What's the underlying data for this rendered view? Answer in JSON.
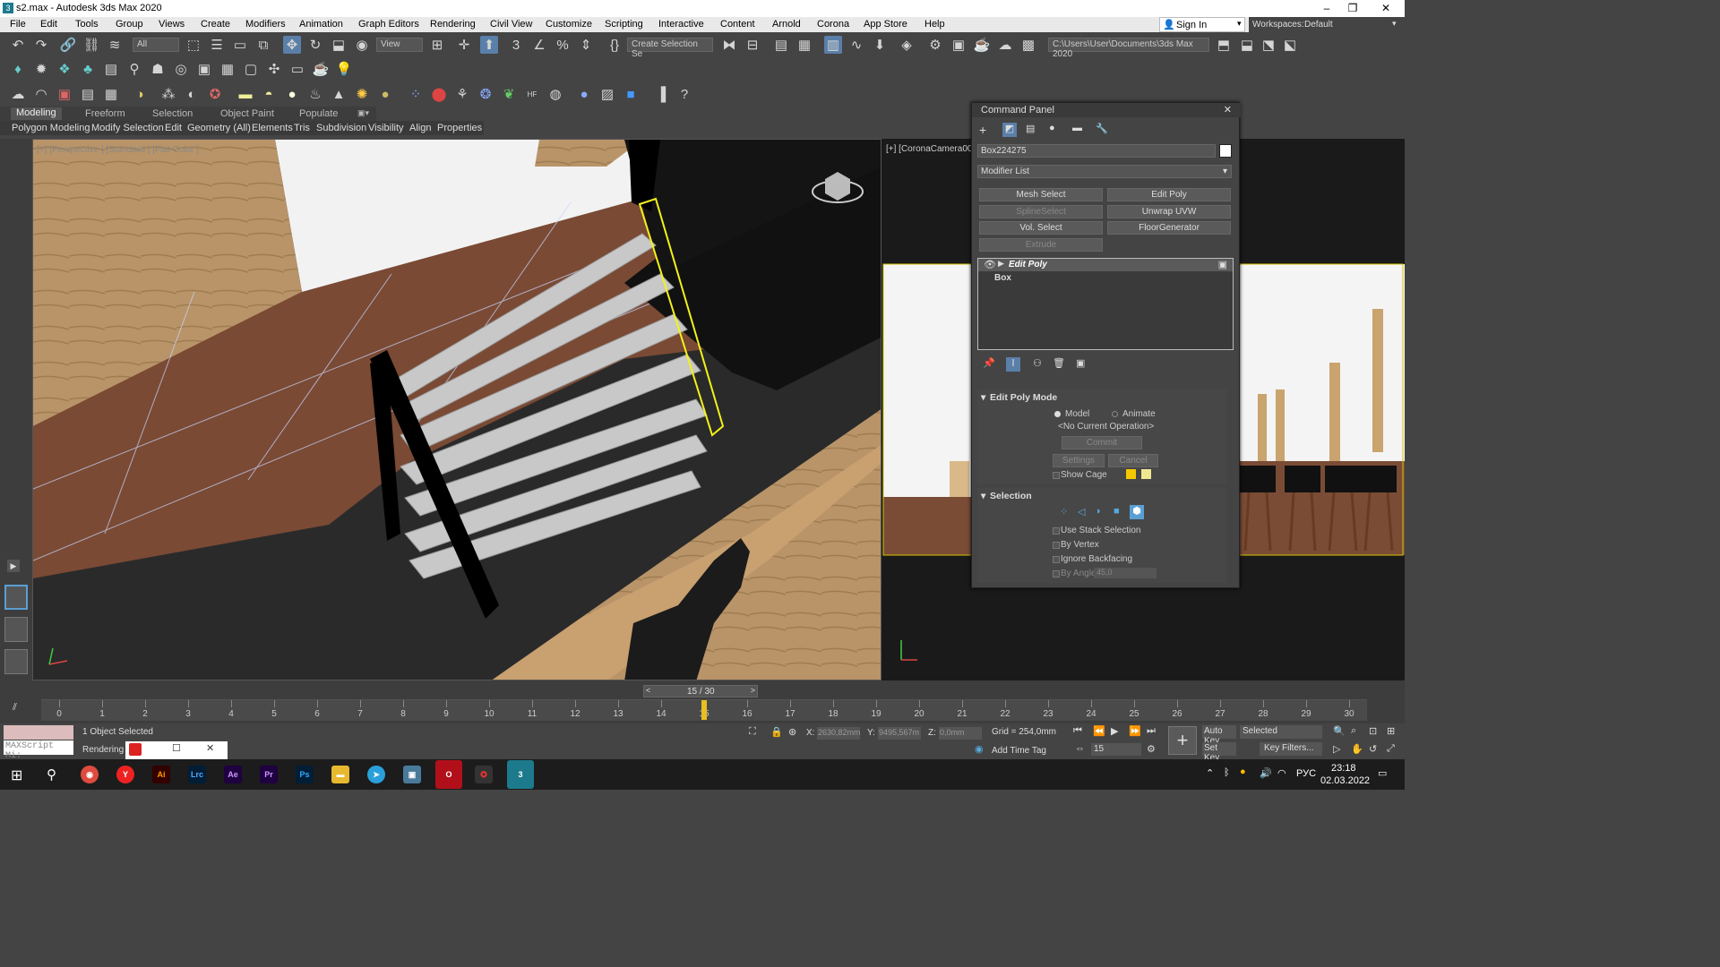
{
  "window": {
    "title": "s2.max - Autodesk 3ds Max 2020",
    "controls": [
      "–",
      "❐",
      "✕"
    ]
  },
  "menu": [
    "File",
    "Edit",
    "Tools",
    "Group",
    "Views",
    "Create",
    "Modifiers",
    "Animation",
    "Graph Editors",
    "Rendering",
    "Civil View",
    "Customize",
    "Scripting",
    "Interactive",
    "Content",
    "Arnold",
    "Corona",
    "App Store",
    "Help"
  ],
  "signin": "Sign In",
  "workspaces": {
    "label": "Workspaces:",
    "value": "Default"
  },
  "toolbar": {
    "filter": "All",
    "ref_coord": "View",
    "selection_set": "Create Selection Se",
    "project_path": "C:\\Users\\User\\Documents\\3ds Max 2020"
  },
  "ribbon": {
    "tabs": [
      "Modeling",
      "Freeform",
      "Selection",
      "Object Paint",
      "Populate"
    ],
    "sub": [
      "Polygon Modeling",
      "Modify Selection",
      "Edit",
      "Geometry (All)",
      "Elements",
      "Tris",
      "Subdivision",
      "Visibility",
      "Align",
      "Properties"
    ]
  },
  "viewport_main": {
    "label": "[+] [Perspective ] [Standard ] [Flat Color ]"
  },
  "viewport_right": {
    "label": "[+] [CoronaCamera00"
  },
  "command_panel": {
    "title": "Command Panel",
    "object_name": "Box224275",
    "modifier_list": "Modifier List",
    "buttons": [
      {
        "label": "Mesh Select",
        "enabled": true
      },
      {
        "label": "Edit Poly",
        "enabled": true
      },
      {
        "label": "SplineSelect",
        "enabled": false
      },
      {
        "label": "Unwrap UVW",
        "enabled": true
      },
      {
        "label": "Vol. Select",
        "enabled": true
      },
      {
        "label": "FloorGenerator",
        "enabled": true
      },
      {
        "label": "Extrude",
        "enabled": false
      }
    ],
    "stack": [
      "Edit Poly",
      "Box"
    ],
    "edit_poly_mode": {
      "header": "Edit Poly Mode",
      "model": "Model",
      "animate": "Animate",
      "operation": "<No Current Operation>",
      "commit": "Commit",
      "settings": "Settings",
      "cancel": "Cancel",
      "show_cage": "Show Cage"
    },
    "selection": {
      "header": "Selection",
      "use_stack": "Use Stack Selection",
      "by_vertex": "By Vertex",
      "ignore_backfacing": "Ignore Backfacing",
      "by_angle": "By Angle:",
      "angle_value": "45,0"
    }
  },
  "timeline": {
    "frame": "15 / 30",
    "ticks": [
      "0",
      "1",
      "2",
      "3",
      "4",
      "5",
      "6",
      "7",
      "8",
      "9",
      "10",
      "11",
      "12",
      "13",
      "14",
      "15",
      "16",
      "17",
      "18",
      "19",
      "20",
      "21",
      "22",
      "23",
      "24",
      "25",
      "26",
      "27",
      "28",
      "29",
      "30"
    ],
    "current_frame": 15,
    "total_frames": 30
  },
  "status": {
    "maxscript": "MAXScript Mi:",
    "selected": "1 Object Selected",
    "rendering": "Rendering T",
    "x_label": "X:",
    "x": "2630,82mm",
    "y_label": "Y:",
    "y": "9495,567m",
    "z_label": "Z:",
    "z": "0,0mm",
    "grid": "Grid = 254,0mm",
    "add_time_tag": "Add Time Tag",
    "auto_key": "Auto Key",
    "set_key": "Set Key",
    "key_mode": "Selected",
    "key_filters": "Key Filters...",
    "frame_field": "15"
  },
  "taskbar": {
    "apps": [
      "Ai",
      "Lrc",
      "Ae",
      "Pr",
      "Ps"
    ],
    "lang": "РУС",
    "time": "23:18",
    "date": "02.03.2022"
  }
}
